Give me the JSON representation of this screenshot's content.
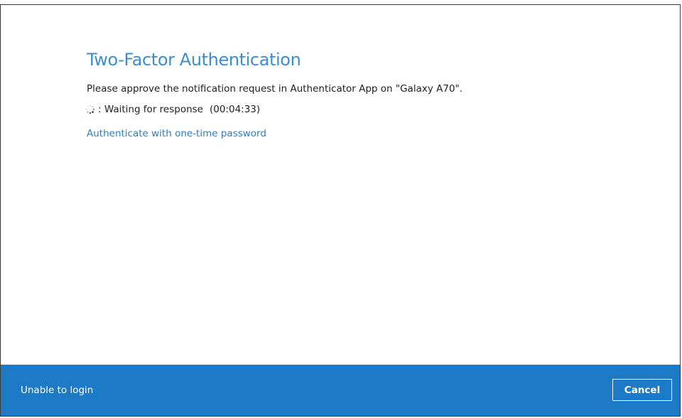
{
  "dialog": {
    "title": "Two-Factor Authentication",
    "message": "Please approve the notification request in Authenticator App on \"Galaxy A70\".",
    "waiting": {
      "label": ": Waiting for response",
      "timer": "(00:04:33)"
    },
    "otp_link": "Authenticate with one-time password"
  },
  "footer": {
    "unable_label": "Unable to login",
    "cancel_label": "Cancel",
    "background_color": "#1d7ac6"
  },
  "colors": {
    "title": "#3b8ed0",
    "link": "#2c7ec3"
  },
  "icons": {
    "spinner": "loading-spinner-icon"
  }
}
